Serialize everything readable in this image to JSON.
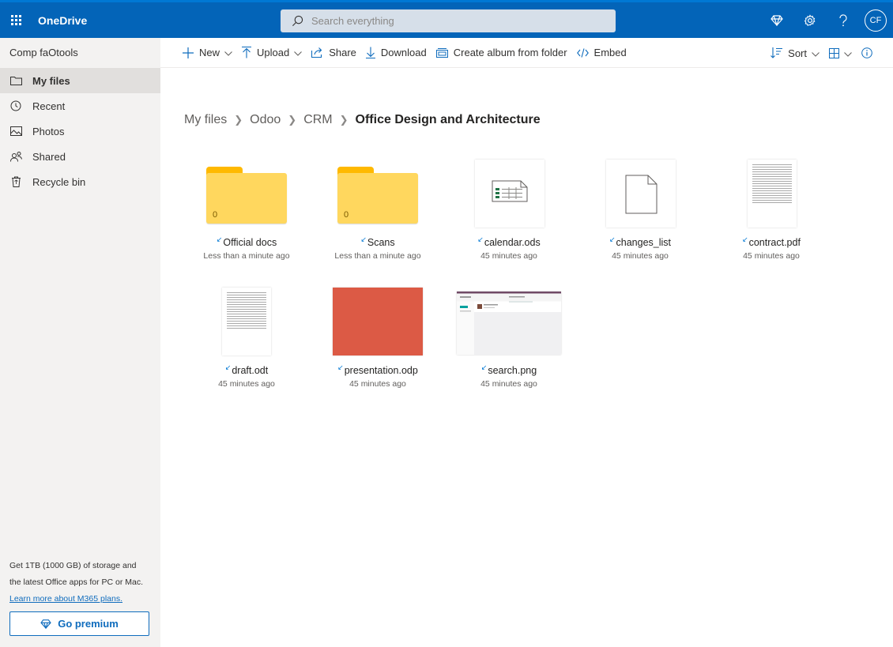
{
  "app": {
    "brand": "OneDrive",
    "avatar_initials": "CF",
    "accent": "#0364b8"
  },
  "search": {
    "placeholder": "Search everything"
  },
  "sidebar": {
    "tenant": "Comp faOtools",
    "items": [
      {
        "label": "My files",
        "icon": "folder-icon",
        "active": true
      },
      {
        "label": "Recent",
        "icon": "clock-icon"
      },
      {
        "label": "Photos",
        "icon": "image-icon"
      },
      {
        "label": "Shared",
        "icon": "people-icon"
      },
      {
        "label": "Recycle bin",
        "icon": "recycle-bin-icon"
      }
    ],
    "promo_line1": "Get 1TB (1000 GB) of storage and",
    "promo_line2": "the latest Office apps for PC or Mac.",
    "promo_link": "Learn more about M365 plans.",
    "premium_button": "Go premium"
  },
  "commands": {
    "new": "New",
    "upload": "Upload",
    "share": "Share",
    "download": "Download",
    "album": "Create album from folder",
    "embed": "Embed",
    "sort": "Sort"
  },
  "breadcrumb": {
    "items": [
      "My files",
      "Odoo",
      "CRM"
    ],
    "current": "Office Design and Architecture"
  },
  "files": [
    {
      "name": "Official docs",
      "modified": "Less than a minute ago",
      "kind": "folder",
      "count": "0"
    },
    {
      "name": "Scans",
      "modified": "Less than a minute ago",
      "kind": "folder",
      "count": "0"
    },
    {
      "name": "calendar.ods",
      "modified": "45 minutes ago",
      "kind": "spreadsheet"
    },
    {
      "name": "changes_list",
      "modified": "45 minutes ago",
      "kind": "generic"
    },
    {
      "name": "contract.pdf",
      "modified": "45 minutes ago",
      "kind": "pdf"
    },
    {
      "name": "draft.odt",
      "modified": "45 minutes ago",
      "kind": "document"
    },
    {
      "name": "presentation.odp",
      "modified": "45 minutes ago",
      "kind": "presentation",
      "color": "#dc5a45"
    },
    {
      "name": "search.png",
      "modified": "45 minutes ago",
      "kind": "image"
    }
  ]
}
